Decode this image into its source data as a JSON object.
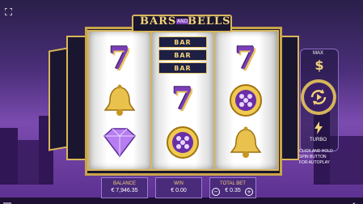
{
  "game": {
    "title": "BARS AND BELLS",
    "title_line1": "BARS",
    "title_and": "AND",
    "title_line2": "BELLS"
  },
  "reels": [
    {
      "symbols": [
        "seven",
        "bell",
        "diamond"
      ]
    },
    {
      "symbols": [
        "triple-bar",
        "seven",
        "coin"
      ]
    },
    {
      "symbols": [
        "seven",
        "coin",
        "bell"
      ]
    }
  ],
  "bar_symbol_label": "BAR",
  "spin_panel": {
    "max_label": "MAX",
    "turbo_label": "TURBO",
    "hint": [
      "CLICK AND HOLD",
      "SPIN BUTTON",
      "FOR AUTOPLAY"
    ]
  },
  "bottom_bar": {
    "balance_label": "BALANCE",
    "balance_value": "€ 7,946.35",
    "win_label": "WIN",
    "win_value": "€ 0.00",
    "bet_label": "TOTAL BET",
    "bet_value": "€ 0.35",
    "minus": "−",
    "plus": "+"
  },
  "colors": {
    "gold": "#d6b55c",
    "purple": "#7a3fb8",
    "panel": "#4a2a7b"
  },
  "icons": [
    "fullscreen-icon",
    "dollar-icon",
    "spin-arrows-icon",
    "lightning-icon",
    "menu-icon",
    "sound-icon"
  ]
}
